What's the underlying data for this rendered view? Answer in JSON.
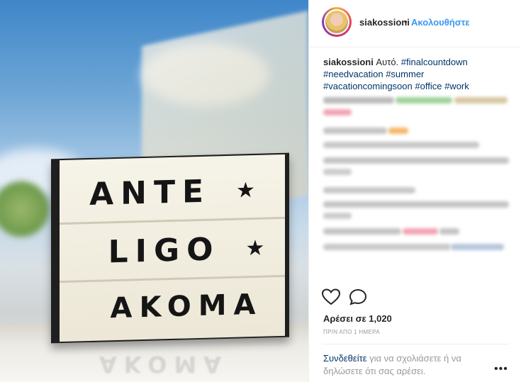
{
  "photo": {
    "sign_lines": [
      "ANTE",
      "LIGO",
      "AKOMA"
    ],
    "star": "★"
  },
  "header": {
    "username": "siakossioni",
    "separator": "•",
    "follow_label": "Ακολουθήστε"
  },
  "caption": {
    "username": "siakossioni",
    "text": " Αυτό. ",
    "hashtags": [
      "#finalcountdown",
      "#needvacation",
      "#summer",
      "#vacationcomingsoon",
      "#office",
      "#work"
    ]
  },
  "engagement": {
    "likes": "Αρέσει σε 1,020",
    "time": "ΠΡΙΝ ΑΠΟ 1 ΗΜΕΡΑ"
  },
  "footer": {
    "login_link": "Συνδεθείτε",
    "login_text": " για να σχολιάσετε ή να δηλώσετε ότι σας αρέσει.",
    "more": "•••"
  },
  "icons": {
    "like": "heart-icon",
    "comment": "comment-icon",
    "more": "more-options-icon"
  }
}
